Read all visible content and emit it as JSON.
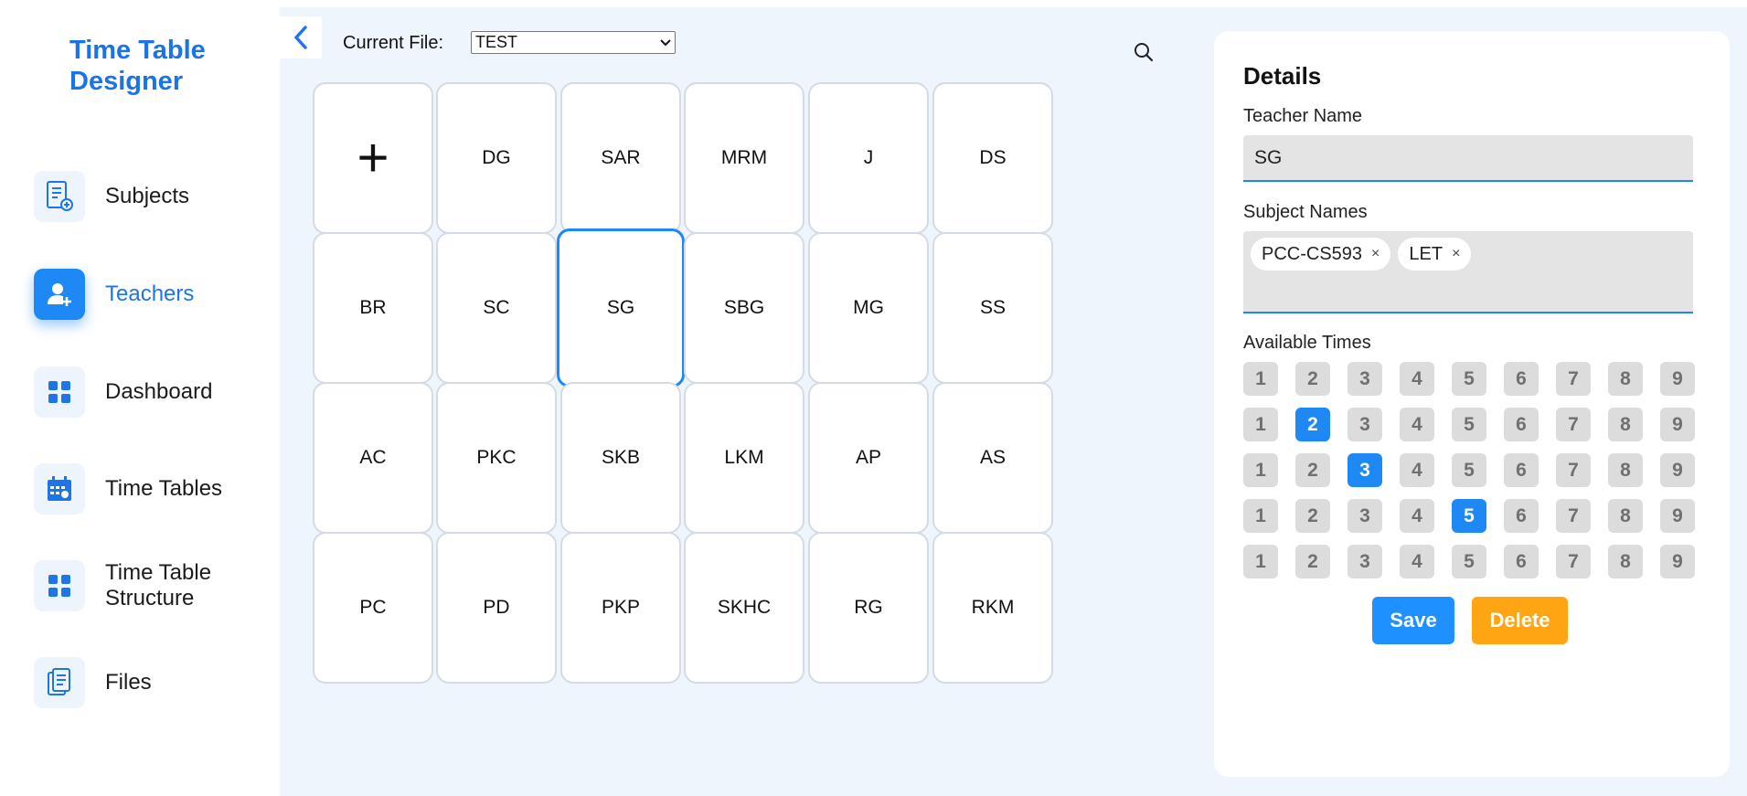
{
  "app": {
    "title": "Time Table Designer"
  },
  "sidebar": {
    "items": [
      {
        "label": "Subjects",
        "icon": "subjects-icon",
        "active": false
      },
      {
        "label": "Teachers",
        "icon": "teacher-add-icon",
        "active": true
      },
      {
        "label": "Dashboard",
        "icon": "dashboard-icon",
        "active": false
      },
      {
        "label": "Time Tables",
        "icon": "calendar-icon",
        "active": false
      },
      {
        "label": "Time Table Structure",
        "icon": "grid-icon",
        "active": false
      },
      {
        "label": "Files",
        "icon": "files-icon",
        "active": false
      }
    ]
  },
  "toolbar": {
    "file_label": "Current File:",
    "file_value": "TEST"
  },
  "teachers": [
    "+",
    "DG",
    "SAR",
    "MRM",
    "J",
    "DS",
    "BR",
    "SC",
    "SG",
    "SBG",
    "MG",
    "SS",
    "AC",
    "PKC",
    "SKB",
    "LKM",
    "AP",
    "AS",
    "PC",
    "PD",
    "PKP",
    "SKHC",
    "RG",
    "RKM"
  ],
  "selected_teacher": "SG",
  "details": {
    "title": "Details",
    "teacher_name_label": "Teacher Name",
    "teacher_name_value": "SG",
    "subject_names_label": "Subject Names",
    "subjects": [
      "PCC-CS593",
      "LET"
    ],
    "chip_remove": "×",
    "available_times_label": "Available Times",
    "time_slots": [
      "1",
      "2",
      "3",
      "4",
      "5",
      "6",
      "7",
      "8",
      "9"
    ],
    "selected_times": [
      [],
      [
        2
      ],
      [
        3
      ],
      [
        5
      ],
      []
    ],
    "save_label": "Save",
    "delete_label": "Delete"
  },
  "colors": {
    "accent": "#1e88f5",
    "delete": "#ffa514",
    "main_bg": "#eef5fd"
  }
}
